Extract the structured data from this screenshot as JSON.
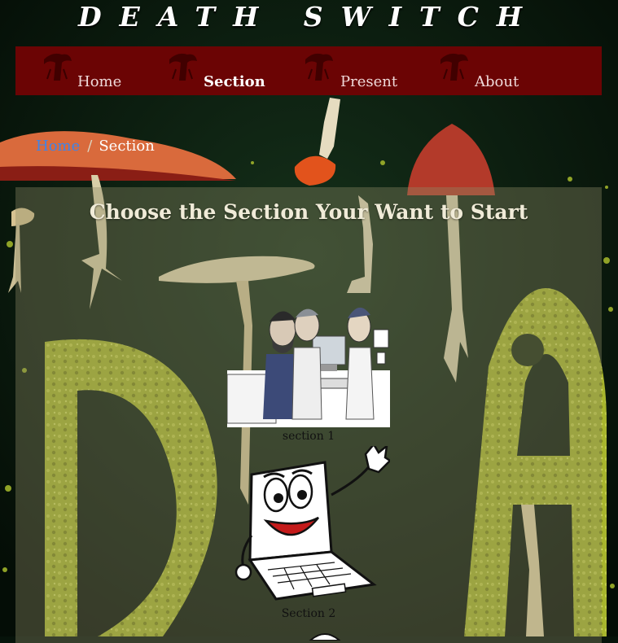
{
  "site": {
    "title": "DEATH SWITCH"
  },
  "nav": {
    "items": [
      {
        "label": "Home"
      },
      {
        "label": "Section",
        "active": true
      },
      {
        "label": "Present"
      },
      {
        "label": "About"
      }
    ]
  },
  "breadcrumb": {
    "home": "Home",
    "separator": "/",
    "current": "Section"
  },
  "main": {
    "heading": "Choose the Section Your Want to Start",
    "sections": [
      {
        "caption": "section 1",
        "image": "people-at-computers-illustration"
      },
      {
        "caption": "Section 2",
        "image": "happy-laptop-cartoon"
      }
    ]
  },
  "colors": {
    "nav_bg": "#6b0404",
    "breadcrumb_link": "#3f84e8",
    "moss": "#a7b52e",
    "page_bg": "#06130a"
  }
}
